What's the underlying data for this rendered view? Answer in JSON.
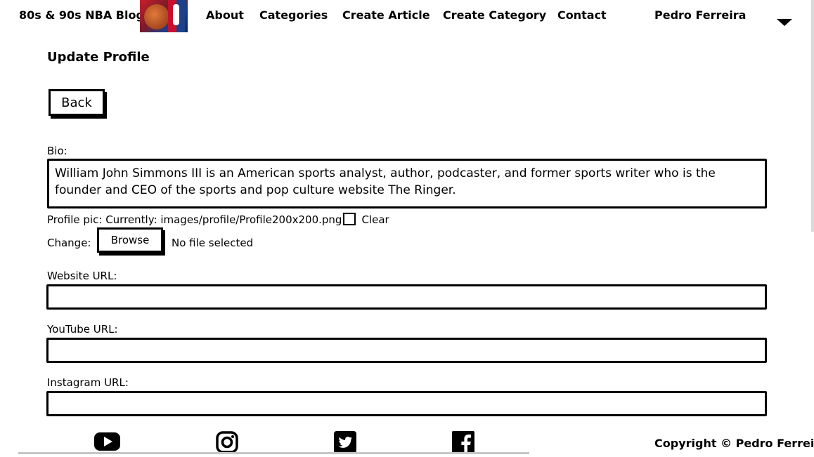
{
  "nav": {
    "brand": "80s & 90s NBA Blog",
    "logo_icon": "nba-logo",
    "links": [
      "About",
      "Categories",
      "Create Article",
      "Create Category",
      "Contact"
    ],
    "user": "Pedro Ferreira",
    "dropdown_icon": "caret-down"
  },
  "form": {
    "title": "Update Profile",
    "back_label": "Back",
    "bio_label": "Bio:",
    "bio_value": "William John Simmons III is an American sports analyst, author, podcaster, and former sports writer who is the founder and CEO of the sports and pop culture website The Ringer.",
    "profile_pic_label": "Profile pic:",
    "currently_label": "Currently:",
    "current_file": "images/profile/Profile200x200.png",
    "clear_label": "Clear",
    "change_label": "Change:",
    "browse_label": "Browse",
    "no_file": "No file selected",
    "website_label": "Website URL:",
    "website_value": "",
    "youtube_label": "YouTube URL:",
    "youtube_value": "",
    "instagram_label": "Instagram URL:",
    "instagram_value": ""
  },
  "footer": {
    "social_icons": [
      "youtube-icon",
      "instagram-icon",
      "twitter-icon",
      "facebook-icon"
    ],
    "copyright": "Copyright © Pedro Ferreira"
  }
}
